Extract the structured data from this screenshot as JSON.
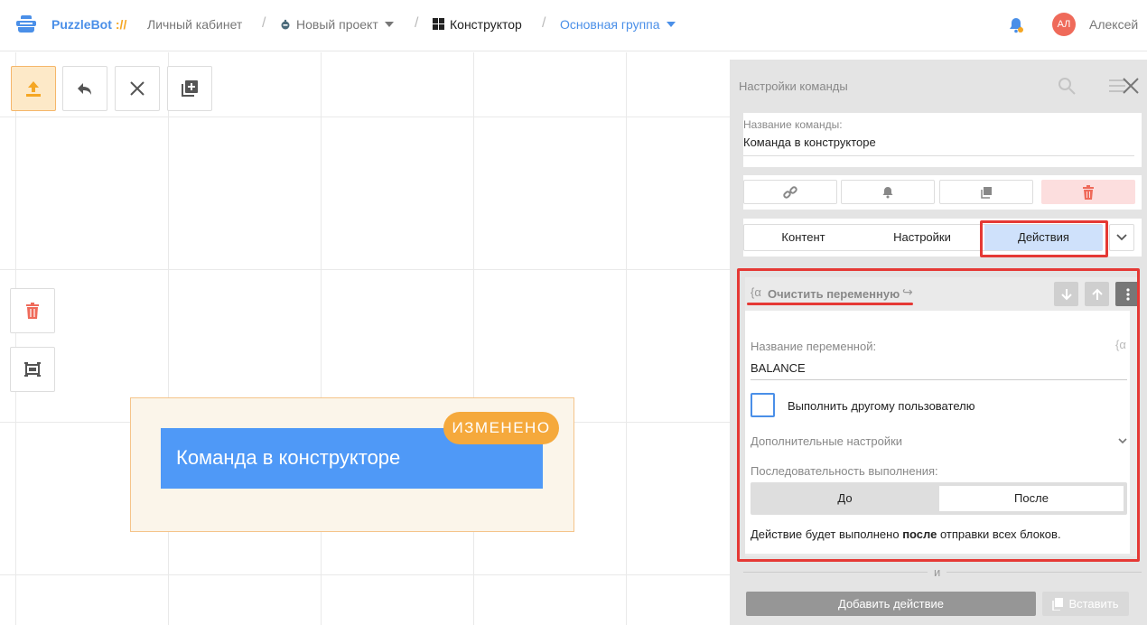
{
  "header": {
    "brand": "PuzzleBot",
    "brand_sep": "://",
    "crumbs": [
      "Личный кабинет",
      "Новый проект",
      "Конструктор",
      "Основная группа"
    ],
    "user_initials": "АЛ",
    "user_name": "Алексей"
  },
  "canvas": {
    "node_title": "Команда в конструкторе",
    "badge": "ИЗМЕНЕНО"
  },
  "panel": {
    "title": "Настройки команды",
    "command_name_label": "Название команды:",
    "command_name_value": "Команда в конструкторе",
    "tabs": [
      "Контент",
      "Настройки",
      "Действия"
    ],
    "active_tab": "Действия",
    "action": {
      "icon_text": "{α",
      "title": "Очистить переменную",
      "variable_label": "Название переменной:",
      "variable_icon_text": "{α",
      "variable_value": "BALANCE",
      "checkbox_label": "Выполнить другому пользователю",
      "advanced_label": "Дополнительные настройки",
      "sequence_label": "Последовательность выполнения:",
      "sequence_options": [
        "До",
        "После"
      ],
      "sequence_selected": "После",
      "desc_prefix": "Действие будет выполнено ",
      "desc_bold": "после",
      "desc_suffix": " отправки всех блоков."
    },
    "and_text": "и",
    "add_action_label": "Добавить действие",
    "paste_label": "Вставить"
  },
  "colors": {
    "brand_blue": "#4a8fe8",
    "accent_orange": "#f5a93c",
    "node_blue": "#4f99f7",
    "highlight_red": "#e53935",
    "active_tab_bg": "#cfe1fb"
  }
}
